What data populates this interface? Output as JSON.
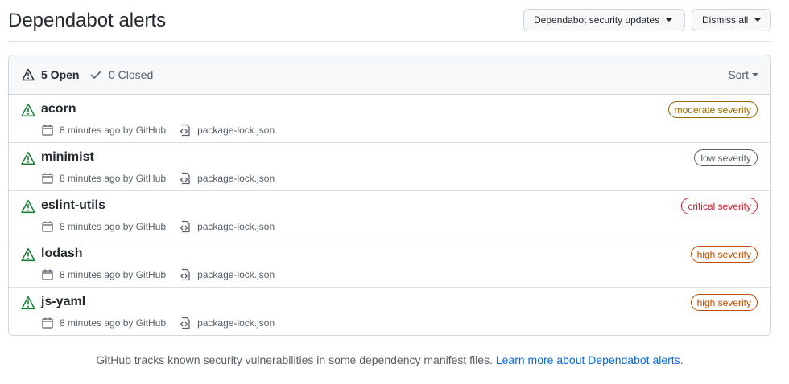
{
  "header": {
    "title": "Dependabot alerts",
    "security_updates_label": "Dependabot security updates",
    "dismiss_all_label": "Dismiss all"
  },
  "filters": {
    "open_label": "5 Open",
    "closed_label": "0 Closed",
    "sort_label": "Sort"
  },
  "alerts": [
    {
      "name": "acorn",
      "meta": "8 minutes ago by GitHub",
      "file": "package-lock.json",
      "severity": "moderate severity",
      "severity_color": "#9a6700"
    },
    {
      "name": "minimist",
      "meta": "8 minutes ago by GitHub",
      "file": "package-lock.json",
      "severity": "low severity",
      "severity_color": "#57606a"
    },
    {
      "name": "eslint-utils",
      "meta": "8 minutes ago by GitHub",
      "file": "package-lock.json",
      "severity": "critical severity",
      "severity_color": "#cf222e"
    },
    {
      "name": "lodash",
      "meta": "8 minutes ago by GitHub",
      "file": "package-lock.json",
      "severity": "high severity",
      "severity_color": "#bc4c00"
    },
    {
      "name": "js-yaml",
      "meta": "8 minutes ago by GitHub",
      "file": "package-lock.json",
      "severity": "high severity",
      "severity_color": "#bc4c00"
    }
  ],
  "footer": {
    "text": "GitHub tracks known security vulnerabilities in some dependency manifest files.",
    "link": "Learn more about Dependabot alerts"
  },
  "colors": {
    "alert_icon": "#1a7f37",
    "link": "#0969da"
  },
  "icons": {
    "alert": "alert-icon",
    "check": "check-icon",
    "calendar": "calendar-icon",
    "file_diff": "file-code-icon"
  }
}
